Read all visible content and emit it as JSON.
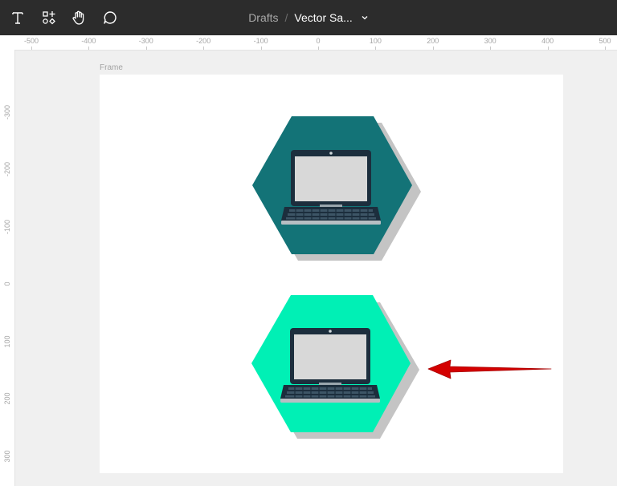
{
  "toolbar": {
    "tools": [
      {
        "name": "text-tool",
        "icon": "text-icon"
      },
      {
        "name": "shapes-tool",
        "icon": "shapes-icon"
      },
      {
        "name": "hand-tool",
        "icon": "hand-icon"
      },
      {
        "name": "comment-tool",
        "icon": "comment-icon"
      }
    ]
  },
  "breadcrumb": {
    "parent": "Drafts",
    "separator": "/",
    "current": "Vector Sa..."
  },
  "ruler": {
    "horizontal_ticks": [
      "-500",
      "-400",
      "-300",
      "-200",
      "-100",
      "0",
      "100",
      "200",
      "300",
      "400",
      "500"
    ],
    "vertical_ticks": [
      "-300",
      "-200",
      "-100",
      "0",
      "100",
      "200",
      "300"
    ]
  },
  "canvas": {
    "frame_label": "Frame"
  },
  "colors": {
    "toolbar_bg": "#2c2c2c",
    "hexagon_dark": "#137377",
    "hexagon_light": "#00f0b5",
    "arrow": "#d40000",
    "laptop_body": "#1c2e3d",
    "laptop_screen": "#d8d8d8"
  }
}
